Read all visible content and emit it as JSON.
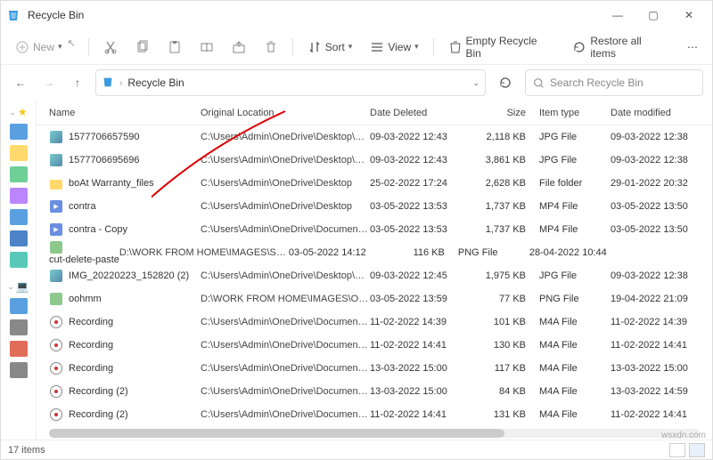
{
  "window": {
    "title": "Recycle Bin"
  },
  "toolbar": {
    "new": "New",
    "sort": "Sort",
    "view": "View",
    "empty": "Empty Recycle Bin",
    "restore": "Restore all items"
  },
  "breadcrumb": {
    "root_icon": "recycle-bin",
    "location": "Recycle Bin"
  },
  "search": {
    "placeholder": "Search Recycle Bin"
  },
  "columns": {
    "name": "Name",
    "orig": "Original Location",
    "deleted": "Date Deleted",
    "size": "Size",
    "type": "Item type",
    "modified": "Date modified"
  },
  "items": [
    {
      "name": "1577706657590",
      "orig": "C:\\Users\\Admin\\OneDrive\\Desktop\\Shiva...",
      "deleted": "09-03-2022 12:43",
      "size": "2,118 KB",
      "type": "JPG File",
      "modified": "09-03-2022 12:38",
      "icon": "img"
    },
    {
      "name": "1577706695696",
      "orig": "C:\\Users\\Admin\\OneDrive\\Desktop\\Shiva...",
      "deleted": "09-03-2022 12:43",
      "size": "3,861 KB",
      "type": "JPG File",
      "modified": "09-03-2022 12:38",
      "icon": "img"
    },
    {
      "name": "boAt Warranty_files",
      "orig": "C:\\Users\\Admin\\OneDrive\\Desktop",
      "deleted": "25-02-2022 17:24",
      "size": "2,628 KB",
      "type": "File folder",
      "modified": "29-01-2022 20:32",
      "icon": "folder"
    },
    {
      "name": "contra",
      "orig": "C:\\Users\\Admin\\OneDrive\\Desktop",
      "deleted": "03-05-2022 13:53",
      "size": "1,737 KB",
      "type": "MP4 File",
      "modified": "03-05-2022 13:50",
      "icon": "vid"
    },
    {
      "name": "contra - Copy",
      "orig": "C:\\Users\\Admin\\OneDrive\\Documents\\T...",
      "deleted": "03-05-2022 13:53",
      "size": "1,737 KB",
      "type": "MP4 File",
      "modified": "03-05-2022 13:50",
      "icon": "vid"
    },
    {
      "name": "cut-delete-paste",
      "orig": "D:\\WORK FROM HOME\\IMAGES\\Systwea...",
      "deleted": "03-05-2022 14:12",
      "size": "116 KB",
      "type": "PNG File",
      "modified": "28-04-2022 10:44",
      "icon": "png",
      "highlight": true
    },
    {
      "name": "IMG_20220223_152820 (2)",
      "orig": "C:\\Users\\Admin\\OneDrive\\Desktop\\Shiva...",
      "deleted": "09-03-2022 12:45",
      "size": "1,975 KB",
      "type": "JPG File",
      "modified": "09-03-2022 12:38",
      "icon": "img"
    },
    {
      "name": "oohmm",
      "orig": "D:\\WORK FROM HOME\\IMAGES\\O&O D...",
      "deleted": "03-05-2022 13:59",
      "size": "77 KB",
      "type": "PNG File",
      "modified": "19-04-2022 21:09",
      "icon": "png"
    },
    {
      "name": "Recording",
      "orig": "C:\\Users\\Admin\\OneDrive\\Documents\\S...",
      "deleted": "11-02-2022 14:39",
      "size": "101 KB",
      "type": "M4A File",
      "modified": "11-02-2022 14:39",
      "icon": "audio"
    },
    {
      "name": "Recording",
      "orig": "C:\\Users\\Admin\\OneDrive\\Documents\\S...",
      "deleted": "11-02-2022 14:41",
      "size": "130 KB",
      "type": "M4A File",
      "modified": "11-02-2022 14:41",
      "icon": "audio"
    },
    {
      "name": "Recording",
      "orig": "C:\\Users\\Admin\\OneDrive\\Documents\\S...",
      "deleted": "13-03-2022 15:00",
      "size": "117 KB",
      "type": "M4A File",
      "modified": "13-03-2022 15:00",
      "icon": "audio"
    },
    {
      "name": "Recording (2)",
      "orig": "C:\\Users\\Admin\\OneDrive\\Documents\\S...",
      "deleted": "13-03-2022 15:00",
      "size": "84 KB",
      "type": "M4A File",
      "modified": "13-03-2022 14:59",
      "icon": "audio"
    },
    {
      "name": "Recording (2)",
      "orig": "C:\\Users\\Admin\\OneDrive\\Documents\\S...",
      "deleted": "11-02-2022 14:41",
      "size": "131 KB",
      "type": "M4A File",
      "modified": "11-02-2022 14:41",
      "icon": "audio"
    }
  ],
  "status": {
    "count": "17 items"
  },
  "watermark": "wsxdn.com"
}
